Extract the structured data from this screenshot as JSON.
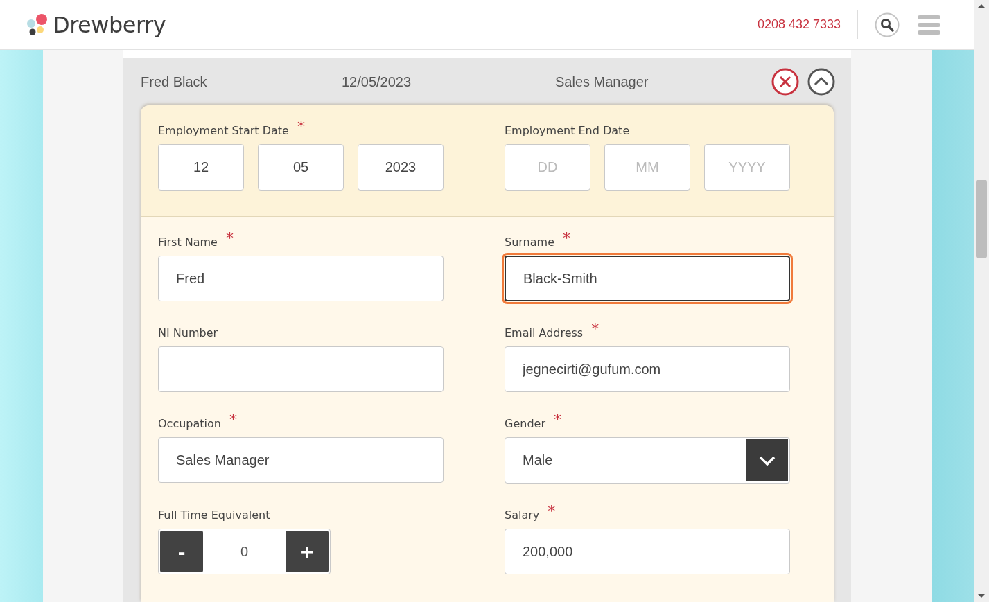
{
  "header": {
    "brand": "Drewberry",
    "phone": "0208 432 7333"
  },
  "summary": {
    "name": "Fred Black",
    "date": "12/05/2023",
    "occupation": "Sales Manager"
  },
  "start_date": {
    "label": "Employment Start Date",
    "asterisk": "*",
    "fields": [
      {
        "value": "12"
      },
      {
        "value": "05"
      },
      {
        "value": "2023"
      }
    ]
  },
  "end_date": {
    "label": "Employment End Date",
    "fields": [
      {
        "placeholder": "DD"
      },
      {
        "placeholder": "MM"
      },
      {
        "placeholder": "YYYY"
      }
    ]
  },
  "fields": [
    {
      "kind": "text",
      "label": "First Name",
      "asterisk": "*",
      "value": "Fred",
      "focused": false
    },
    {
      "kind": "text",
      "label": "Surname",
      "asterisk": "*",
      "value": "Black-Smith",
      "focused": true
    },
    {
      "kind": "text",
      "label": "NI Number",
      "focused": false
    },
    {
      "kind": "text",
      "label": "Email Address",
      "asterisk": "*",
      "value": "jegnecirti@gufum.com",
      "focused": false
    },
    {
      "kind": "text",
      "label": "Occupation",
      "asterisk": "*",
      "value": "Sales Manager",
      "focused": false
    },
    {
      "kind": "select",
      "label": "Gender",
      "asterisk": "*",
      "value": "Male",
      "focused": false
    },
    {
      "kind": "stepper",
      "label": "Full Time Equivalent",
      "value": "0",
      "minus": "-",
      "plus": "+",
      "focused": false
    },
    {
      "kind": "text",
      "label": "Salary",
      "asterisk": "*",
      "value": "200,000",
      "focused": false
    }
  ]
}
